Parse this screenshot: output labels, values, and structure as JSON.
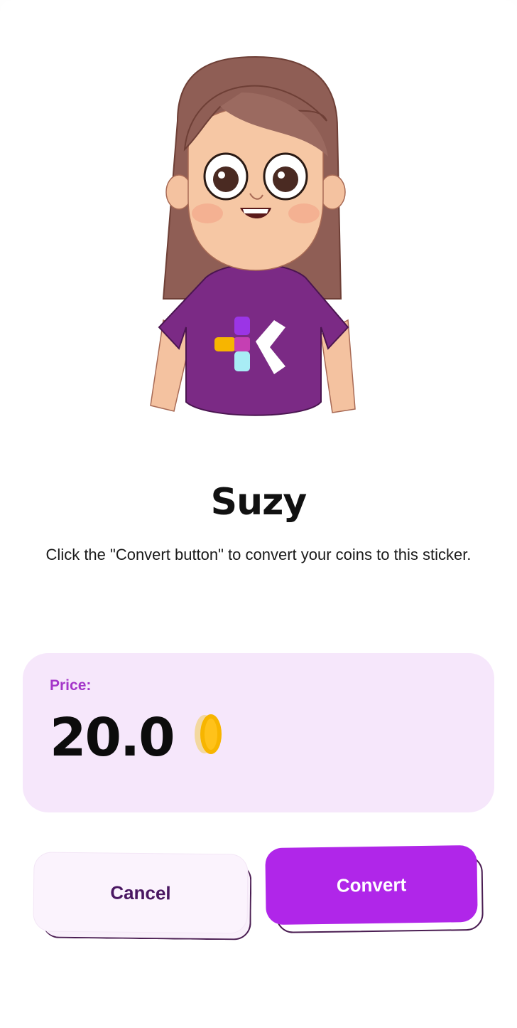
{
  "sticker": {
    "name": "Suzy",
    "image_icon": "girl-avatar-illustration",
    "shirt_logo_letter": "K"
  },
  "instructions": "Click the \"Convert button\" to convert your coins to this sticker.",
  "price": {
    "label": "Price:",
    "value": "20.0",
    "currency_icon": "coin-icon"
  },
  "actions": {
    "cancel_label": "Cancel",
    "convert_label": "Convert"
  },
  "colors": {
    "accent": "#b026e9",
    "price_label": "#a435c9",
    "price_card_bg": "#f6e7fb",
    "cancel_text": "#4a1762",
    "coin": "#f7b500"
  }
}
